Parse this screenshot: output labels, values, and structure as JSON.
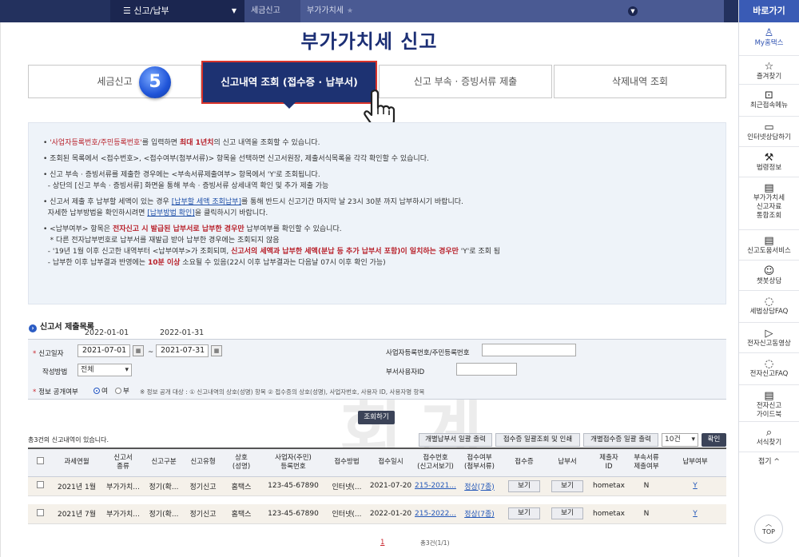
{
  "topnav": {
    "menu": "신고/납부",
    "crumb1": "세금신고",
    "crumb2": "부가가치세"
  },
  "title": "부가가치세 신고",
  "tabs": [
    {
      "label": "세금신고"
    },
    {
      "label": "신고내역 조회 (접수증 · 납부서)"
    },
    {
      "label": "신고 부속 · 증빙서류 제출"
    },
    {
      "label": "삭제내역 조회"
    }
  ],
  "step": "5",
  "notice": {
    "l1a": "'사업자등록번호/주민등록번호'",
    "l1b": "를 입력하면 ",
    "l1c": "최대 1년치",
    "l1d": "의 신고 내역을 조회할 수 있습니다.",
    "l2": "조회된 목록에서 <접수번호>, <접수여부(첨부서류)> 항목을 선택하면 신고서원장, 제출서식목록을 각각 확인할 수 있습니다.",
    "l3": "신고 부속 · 증빙서류를 제출한 경우에는 <부속서류제출여부> 항목에서 'Y'로 조회됩니다.",
    "l4": "- 상단의 [신고 부속 · 증빙서류] 화면을 통해 부속 · 증빙서류 상세내역 확인 및 추가 제출 가능",
    "l5a": "신고서 제출 후 납부할 세액이 있는 경우 ",
    "l5b": "[납부할 세액 조회납부]",
    "l5c": "를 통해 반드시 신고기간 마지막 날 23시 30분 까지 납부하시기 바랍니다.",
    "l6a": "자세한 납부방법을 확인하시려면 ",
    "l6b": "[납부방법 확인]",
    "l6c": "을 클릭하시기 바랍니다.",
    "l7a": "<납부여부> 항목은 ",
    "l7b": "전자신고 시 발급된 납부서로 납부한 경우만",
    "l7c": " 납부여부를 확인할 수 있습니다.",
    "l8": "* 다른 전자납부번호로 납부서를 재발급 받아 납부한 경우에는 조회되지 않음",
    "l9a": "- '19년 1월 이후 신고한 내역부터 <납부여부>가 조회되며, ",
    "l9b": "신고서의 세액과 납부한 세액(분납 등 추가 납부서 포함)이 일치하는 경우만",
    "l9c": " 'Y'로 조회 됨",
    "l10a": "- 납부한 이후 납부결과 반영에는 ",
    "l10b": "10분 이상",
    "l10c": " 소요될 수 있음(22시 이후 납부결과는 다음날 07시 이후 확인 가능)"
  },
  "watermark": {
    "w1": "안",
    "w2": "임",
    "w3": "세",
    "w4": "무",
    "w5": "회",
    "w6": "계"
  },
  "form": {
    "section_title": "신고서 제출목록",
    "hint_from": "2022-01-01",
    "hint_to": "2022-01-31",
    "period_label": "신고일자",
    "date_from": "2021-07-01",
    "date_to": "2021-07-31",
    "tilde": "~",
    "method_label": "작성방법",
    "method_value": "전체",
    "bizno_label": "사업자등록번호/주민등록번호",
    "dept_label": "부서사용자ID",
    "disclose_label": "정보 공개여부",
    "yes": "여",
    "no": "부",
    "disclose_note": "※ 정보 공개 대상 : ① 신고내역의 상호(성명) 항목 ② 접수증의 상호(성명), 사업자번호, 사용자 ID, 사용자명 항목",
    "search_btn": "조회하기"
  },
  "list": {
    "count_text": "총3건의 신고내역이 있습니다.",
    "btn_print_pay": "개별납부서 일괄 출력",
    "btn_print_receipt": "접수증 일괄조회 및 인쇄",
    "btn_print_each": "개별접수증 일괄 출력",
    "page_size": "10건",
    "confirm": "확인"
  },
  "table": {
    "headers": [
      "과세연월",
      "신고서\n종류",
      "신고구분",
      "신고유형",
      "상호\n(성명)",
      "사업자(주민)\n등록번호",
      "접수방법",
      "접수일시",
      "접수번호\n(신고서보기)",
      "접수여부\n(첨부서류)",
      "접수증",
      "납부서",
      "제출자\nID",
      "부속서류\n제출여부",
      "납부여부"
    ],
    "rows": [
      {
        "period": "2021년 1월",
        "kind": "부가가치...",
        "div": "정기(확...",
        "type": "정기신고",
        "name": "홈택스",
        "biz": "123-45-67890",
        "method": "인터넷(...",
        "date": "2021-07-20",
        "no": "215-2021...",
        "status": "정상(7종)",
        "receipt": "보기",
        "pay": "보기",
        "id": "hometax",
        "attach": "N",
        "paid": "Y"
      },
      {
        "period": "2021년 7월",
        "kind": "부가가치...",
        "div": "정기(확...",
        "type": "정기신고",
        "name": "홈택스",
        "biz": "123-45-67890",
        "method": "인터넷(...",
        "date": "2022-01-20",
        "no": "215-2022...",
        "status": "정상(7종)",
        "receipt": "보기",
        "pay": "보기",
        "id": "hometax",
        "attach": "N",
        "paid": "Y"
      }
    ]
  },
  "pager": {
    "current": "1",
    "total": "총3건(1/1)"
  },
  "sidebar": {
    "head": "바로가기",
    "items": [
      "My홈택스",
      "즐겨찾기",
      "최근접속메뉴",
      "인터넷상담하기",
      "법령정보",
      "부가가치세\n신고자료\n통합조회",
      "신고도움서비스",
      "챗봇상담",
      "세법상담FAQ",
      "전자신고동영상",
      "전자신고FAQ",
      "전자신고\n가이드북",
      "서식찾기"
    ],
    "fold": "접기 ^",
    "top": "TOP"
  }
}
